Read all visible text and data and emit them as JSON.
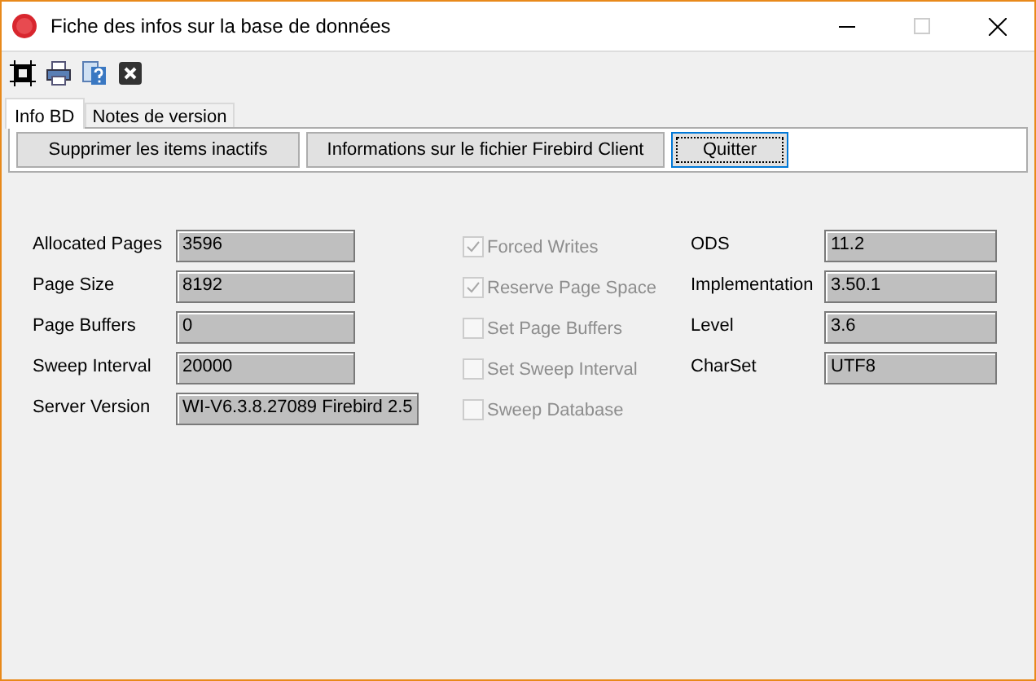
{
  "window": {
    "title": "Fiche des infos sur la base de données"
  },
  "tabs": [
    {
      "label": "Info BD",
      "selected": true
    },
    {
      "label": "Notes de version",
      "selected": false
    }
  ],
  "buttons": [
    {
      "label": "Supprimer les items inactifs",
      "focused": false
    },
    {
      "label": "Informations sur le fichier Firebird Client",
      "focused": false
    },
    {
      "label": "Quitter",
      "focused": true
    }
  ],
  "left_fields": [
    {
      "label": "Allocated Pages",
      "value": "3596"
    },
    {
      "label": "Page Size",
      "value": "8192"
    },
    {
      "label": "Page Buffers",
      "value": "0"
    },
    {
      "label": "Sweep Interval",
      "value": "20000"
    },
    {
      "label": "Server Version",
      "value": "WI-V6.3.8.27089 Firebird 2.5"
    }
  ],
  "checkboxes": [
    {
      "label": "Forced Writes",
      "checked": true,
      "disabled": true
    },
    {
      "label": "Reserve Page Space",
      "checked": true,
      "disabled": true
    },
    {
      "label": "Set Page Buffers",
      "checked": false,
      "disabled": true
    },
    {
      "label": "Set Sweep Interval",
      "checked": false,
      "disabled": true
    },
    {
      "label": "Sweep Database",
      "checked": false,
      "disabled": true
    }
  ],
  "right_fields": [
    {
      "label": "ODS",
      "value": "11.2"
    },
    {
      "label": "Implementation",
      "value": "3.50.1"
    },
    {
      "label": "Level",
      "value": "3.6"
    },
    {
      "label": "CharSet",
      "value": "UTF8"
    }
  ]
}
